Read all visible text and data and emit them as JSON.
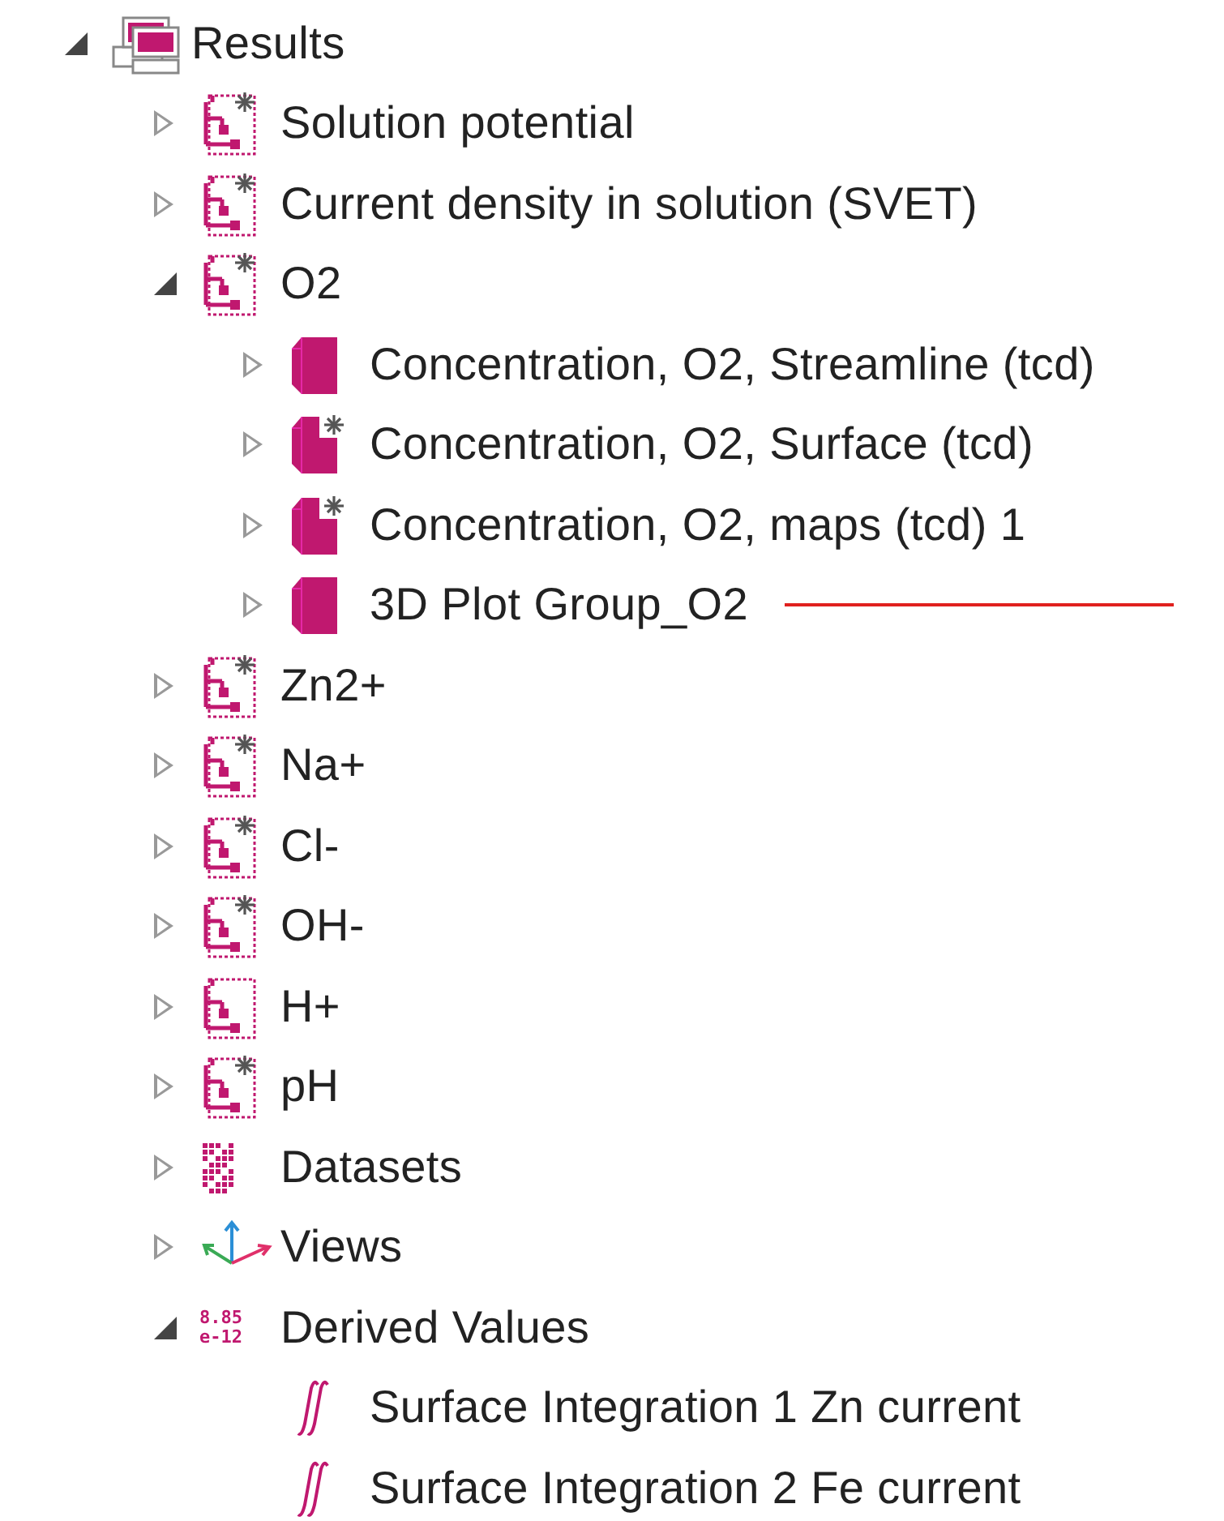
{
  "tree": [
    {
      "label": "Results",
      "kind": "results",
      "expanded": true,
      "children": [
        {
          "label": "Solution potential",
          "kind": "plot-group",
          "expanded": false
        },
        {
          "label": "Current density in solution (SVET)",
          "kind": "plot-group",
          "expanded": false
        },
        {
          "label": "O2",
          "kind": "plot-group",
          "expanded": true,
          "children": [
            {
              "label": "Concentration, O2, Streamline (tcd)",
              "kind": "plot-3d",
              "expanded": false
            },
            {
              "label": "Concentration, O2, Surface (tcd)",
              "kind": "plot-3d-new",
              "expanded": false
            },
            {
              "label": "Concentration, O2, maps (tcd) 1",
              "kind": "plot-3d-new",
              "expanded": false
            },
            {
              "label": "3D Plot Group_O2",
              "kind": "plot-3d",
              "expanded": false,
              "marked": true
            }
          ]
        },
        {
          "label": "Zn2+",
          "kind": "plot-group",
          "expanded": false
        },
        {
          "label": "Na+",
          "kind": "plot-group",
          "expanded": false
        },
        {
          "label": "Cl-",
          "kind": "plot-group",
          "expanded": false
        },
        {
          "label": "OH-",
          "kind": "plot-group",
          "expanded": false
        },
        {
          "label": "H+",
          "kind": "plot-group-plain",
          "expanded": false
        },
        {
          "label": "pH",
          "kind": "plot-group",
          "expanded": false
        },
        {
          "label": "Datasets",
          "kind": "datasets",
          "expanded": false
        },
        {
          "label": "Views",
          "kind": "views",
          "expanded": false
        },
        {
          "label": "Derived Values",
          "kind": "derived",
          "icon_lines": [
            "8.85",
            "e-12"
          ],
          "expanded": true,
          "children": [
            {
              "label": "Surface Integration 1 Zn current",
              "kind": "integration"
            },
            {
              "label": "Surface Integration 2 Fe current",
              "kind": "integration"
            }
          ]
        }
      ]
    }
  ]
}
